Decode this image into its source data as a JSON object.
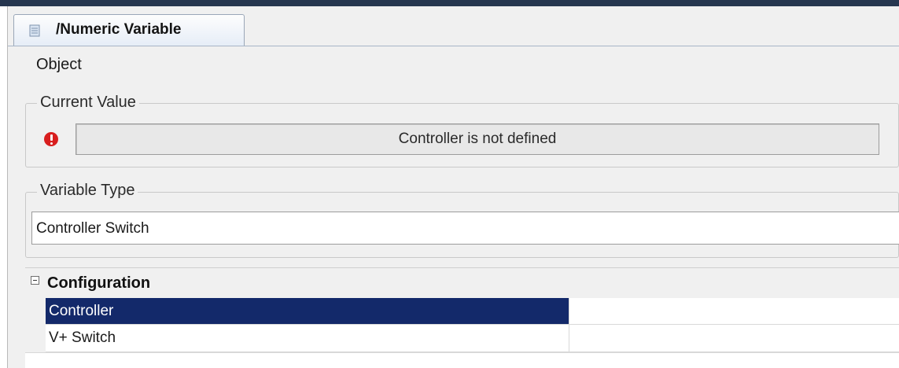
{
  "tab": {
    "icon": "document-icon",
    "title": "/Numeric Variable"
  },
  "object_label": "Object",
  "current_value": {
    "legend": "Current Value",
    "status_icon": "error-icon",
    "status_color": "#d81e1e",
    "value": "Controller is not defined"
  },
  "variable_type": {
    "legend": "Variable Type",
    "value": "Controller Switch"
  },
  "configuration": {
    "title": "Configuration",
    "rows": [
      {
        "name": "Controller",
        "value": "",
        "selected": true
      },
      {
        "name": "V+ Switch",
        "value": "",
        "selected": false
      }
    ],
    "selection_color": "#13296a"
  }
}
